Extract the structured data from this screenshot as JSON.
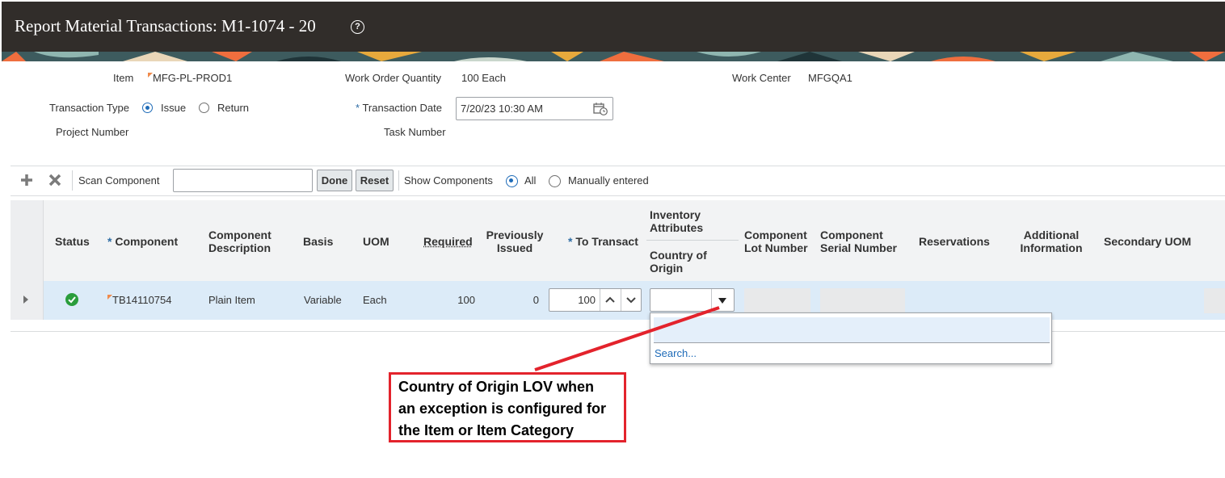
{
  "header": {
    "title": "Report Material Transactions: M1-1074 - 20",
    "help_icon": "?"
  },
  "form": {
    "item_label": "Item",
    "item_value": "MFG-PL-PROD1",
    "work_order_qty_label": "Work Order Quantity",
    "work_order_qty_value": "100 Each",
    "work_center_label": "Work Center",
    "work_center_value": "MFGQA1",
    "transaction_type_label": "Transaction Type",
    "issue_label": "Issue",
    "return_label": "Return",
    "transaction_date_label": "Transaction Date",
    "transaction_date_value": "7/20/23 10:30 AM",
    "project_number_label": "Project Number",
    "task_number_label": "Task Number",
    "required_marker": "*"
  },
  "toolbar": {
    "scan_label": "Scan Component",
    "scan_value": "",
    "done_label": "Done",
    "reset_label": "Reset",
    "show_label": "Show Components",
    "all_label": "All",
    "manual_label": "Manually entered"
  },
  "table": {
    "headers": {
      "status": "Status",
      "component": "Component",
      "description_1": "Component",
      "description_2": "Description",
      "basis": "Basis",
      "uom": "UOM",
      "required": "Required",
      "prev_1": "Previously",
      "prev_2": "Issued",
      "to_transact": "To Transact",
      "inv_1": "Inventory",
      "inv_2": "Attributes",
      "coo_1": "Country of",
      "coo_2": "Origin",
      "lot_1": "Component",
      "lot_2": "Lot Number",
      "serial_1": "Component",
      "serial_2": "Serial Number",
      "reservations": "Reservations",
      "add_1": "Additional",
      "add_2": "Information",
      "secondary_uom": "Secondary UOM"
    },
    "row": {
      "component": "TB14110754",
      "description": "Plain Item",
      "basis": "Variable",
      "uom": "Each",
      "required": "100",
      "previously_issued": "0",
      "to_transact": "100",
      "country_of_origin": ""
    }
  },
  "lov": {
    "search_label": "Search..."
  },
  "callout": {
    "line1": "Country of Origin LOV when",
    "line2": "an exception is configured for",
    "line3": "the Item or Item Category"
  },
  "colors": {
    "header_bg": "#312d2a",
    "selected_row": "#dcebf8",
    "accent": "#1e6bb8",
    "callout": "#e3232c"
  }
}
